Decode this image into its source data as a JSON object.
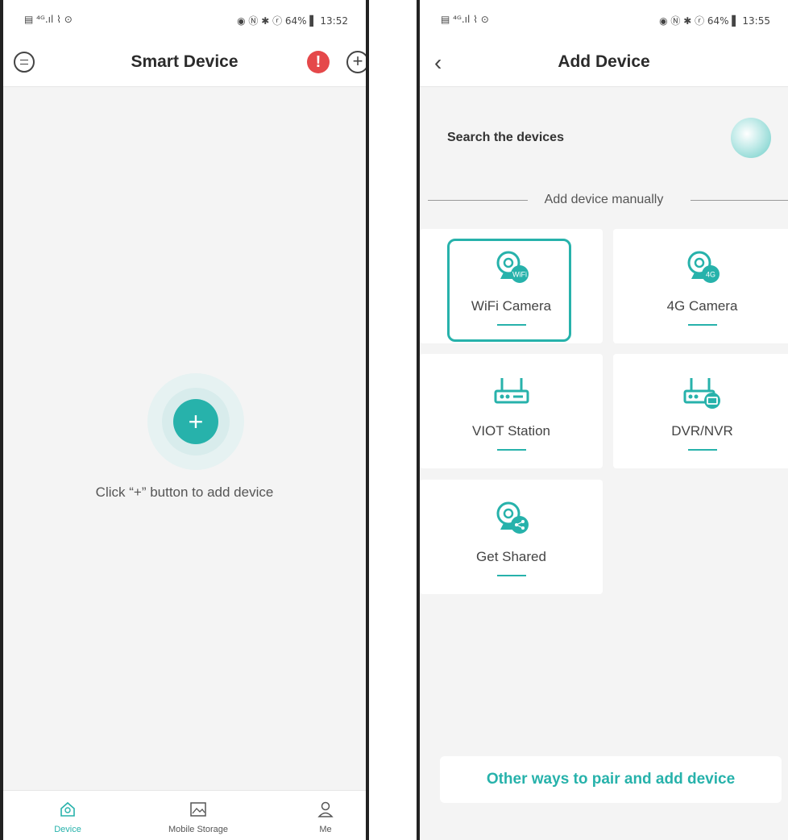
{
  "left_screen": {
    "status": {
      "left": "▤ ⁴ᴳ.ıl ⌇ ⊙",
      "right": "◉ Ⓝ ✱ ⓡ 64% ▌ 13:52"
    },
    "title": "Smart Device",
    "add_symbol": "+",
    "hint": "Click “+” button to add device",
    "tabs": [
      {
        "label": "Device",
        "icon": "home-icon"
      },
      {
        "label": "Mobile Storage",
        "icon": "image-icon"
      },
      {
        "label": "Me",
        "icon": "person-icon"
      }
    ],
    "accent": "#27b2ab",
    "alert_color": "#e5484a"
  },
  "right_screen": {
    "status": {
      "left": "▤ ⁴ᴳ.ıl ⌇ ⊙",
      "right": "◉ Ⓝ ✱ ⓡ 64% ▌ 13:55"
    },
    "title": "Add Device",
    "search_label": "Search the devices",
    "divider_label": "Add device manually",
    "cards": [
      {
        "label": "WiFi Camera",
        "badge": "WiFi",
        "icon": "wifi-camera-icon"
      },
      {
        "label": "4G Camera",
        "badge": "4G",
        "icon": "4g-camera-icon"
      },
      {
        "label": "VIOT Station",
        "icon": "router-icon"
      },
      {
        "label": "DVR/NVR",
        "icon": "dvr-icon"
      },
      {
        "label": "Get Shared",
        "icon": "share-camera-icon"
      }
    ],
    "other_button": "Other ways to pair and add device"
  }
}
